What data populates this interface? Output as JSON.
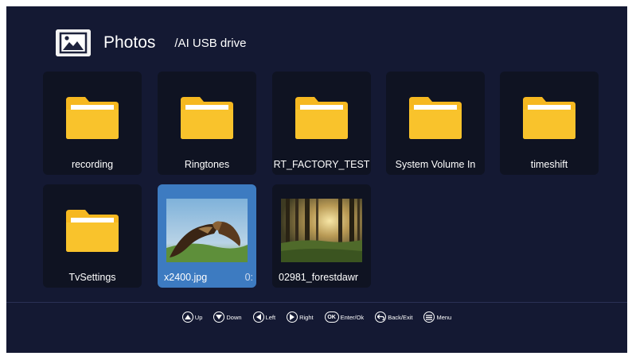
{
  "header": {
    "title": "Photos",
    "path": "/AI USB drive",
    "icon": "photos-icon"
  },
  "tiles": [
    {
      "label": "recording",
      "kind": "folder"
    },
    {
      "label": "Ringtones",
      "kind": "folder"
    },
    {
      "label": "RT_FACTORY_TEST",
      "kind": "folder"
    },
    {
      "label": "System Volume In",
      "kind": "folder"
    },
    {
      "label": "timeshift",
      "kind": "folder"
    },
    {
      "label": "TvSettings",
      "kind": "folder"
    },
    {
      "label": "x2400.jpg",
      "label_extra": "0:",
      "kind": "image",
      "selected": true,
      "thumbnail": "eagle-photo"
    },
    {
      "label": "02981_forestdawr",
      "kind": "image",
      "thumbnail": "forest-photo"
    }
  ],
  "hints": [
    {
      "icon": "up-icon",
      "label": "Up"
    },
    {
      "icon": "down-icon",
      "label": "Down"
    },
    {
      "icon": "left-icon",
      "label": "Left"
    },
    {
      "icon": "right-icon",
      "label": "Right"
    },
    {
      "icon": "ok-icon",
      "label": "Enter/Ok",
      "glyph": "OK"
    },
    {
      "icon": "back-icon",
      "label": "Back/Exit"
    },
    {
      "icon": "menu-icon",
      "label": "Menu"
    }
  ],
  "colors": {
    "background": "#141933",
    "tile": "#0f1322",
    "selected": "#3d7bc1",
    "folder": "#f6b820"
  }
}
